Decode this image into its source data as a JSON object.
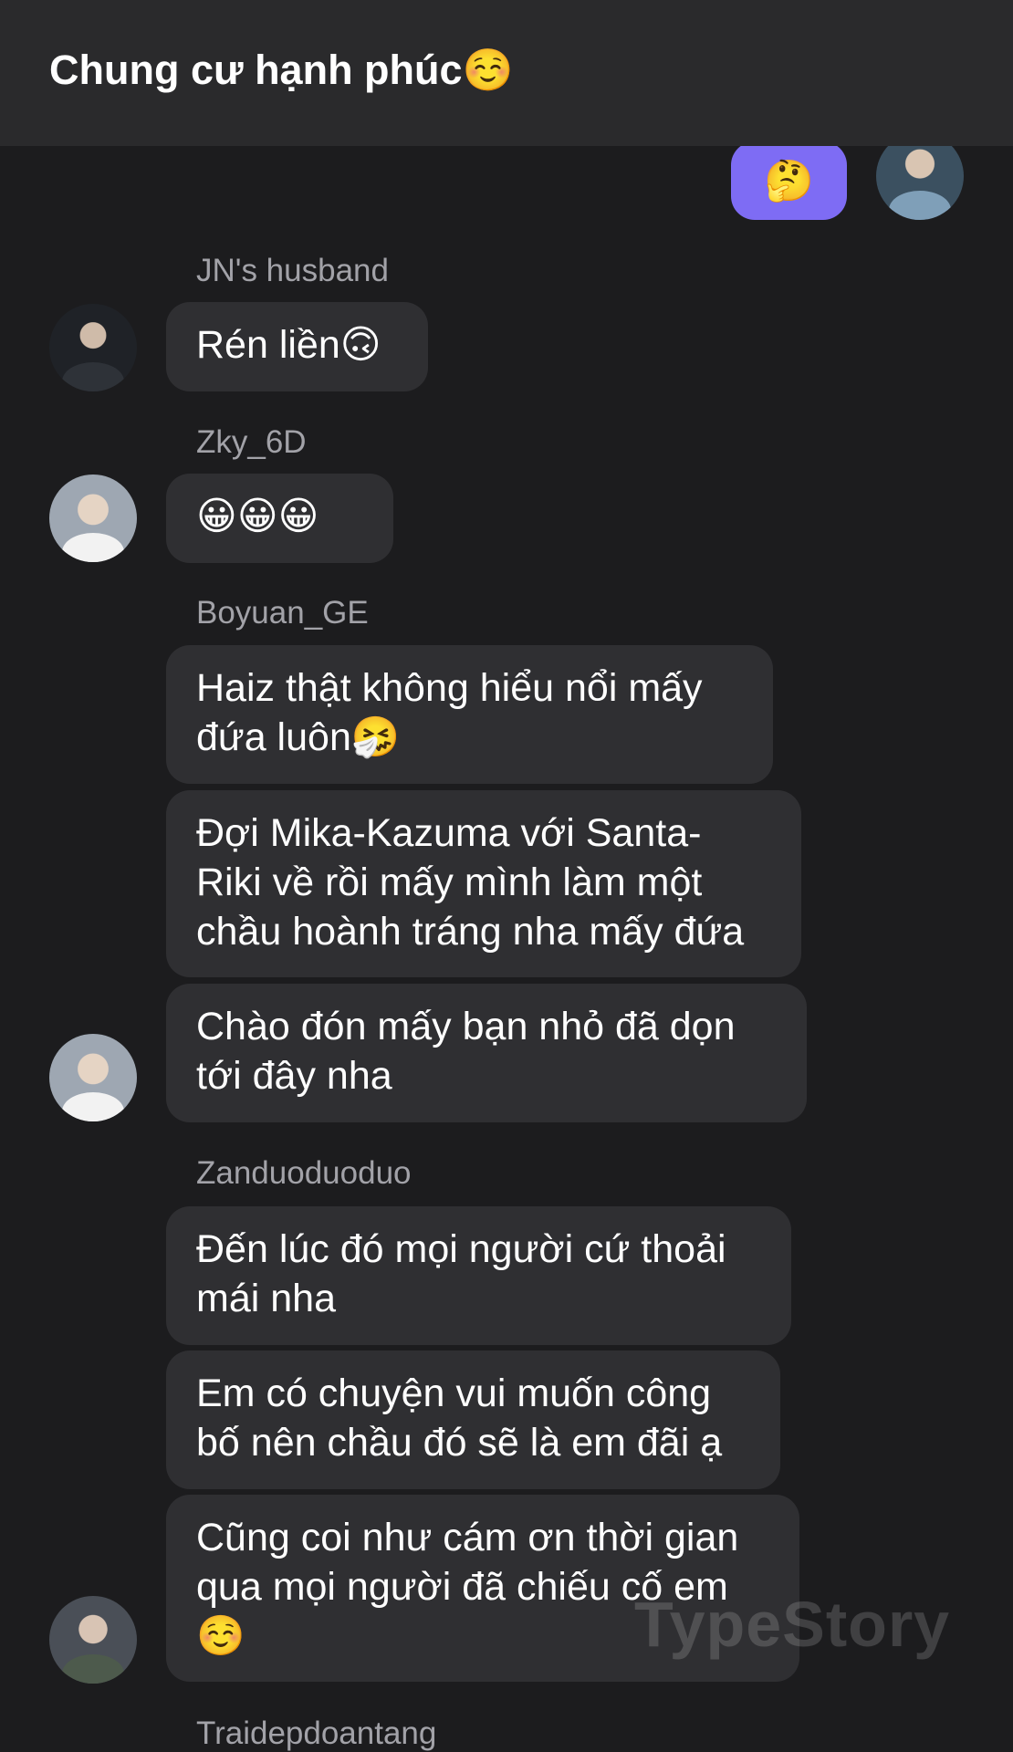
{
  "header": {
    "title": "Chung cư hạnh phúc☺️"
  },
  "my_message": {
    "text": "🤔"
  },
  "messages": [
    {
      "sender": "JN's husband",
      "bubbles": [
        "Rén liền🙃"
      ]
    },
    {
      "sender": "Zky_6D",
      "bubbles": [
        "😀😀😀"
      ]
    },
    {
      "sender": "Boyuan_GE",
      "bubbles": [
        "Haiz thật không hiểu nổi mấy\nđứa luôn🤧",
        "Đợi Mika-Kazuma với Santa-\nRiki về rồi mấy mình làm một\nchầu hoành tráng nha mấy đứa",
        "Chào đón mấy bạn nhỏ đã dọn\ntới đây nha"
      ]
    },
    {
      "sender": "Zanduoduoduo",
      "bubbles": [
        "Đến lúc đó mọi người cứ thoải\nmái nha",
        "Em có chuyện vui muốn công\nbố nên chầu đó sẽ là em đãi ạ",
        "Cũng coi như cám ơn thời gian\nqua mọi người đã chiếu cố em\n☺️"
      ]
    },
    {
      "sender": "Traidepdoantang",
      "bubbles": []
    }
  ],
  "watermark": "TypeStory"
}
